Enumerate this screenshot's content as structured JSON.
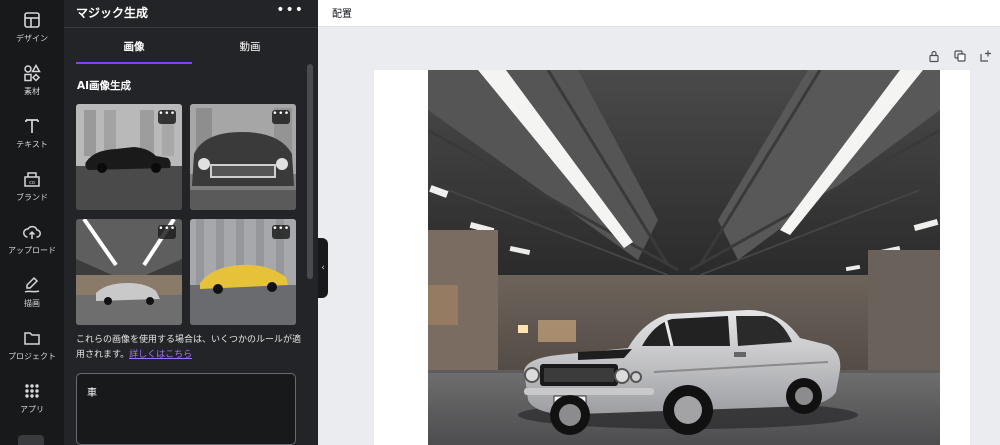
{
  "rail": {
    "items": [
      {
        "label": "デザイン",
        "icon": "layout-icon"
      },
      {
        "label": "素材",
        "icon": "shapes-icon"
      },
      {
        "label": "テキスト",
        "icon": "text-icon"
      },
      {
        "label": "ブランド",
        "icon": "brand-icon"
      },
      {
        "label": "アップロード",
        "icon": "upload-cloud-icon"
      },
      {
        "label": "描画",
        "icon": "draw-icon"
      },
      {
        "label": "プロジェクト",
        "icon": "folder-icon"
      },
      {
        "label": "アプリ",
        "icon": "apps-grid-icon"
      }
    ]
  },
  "panel": {
    "title": "マジック生成",
    "more": "•••",
    "tabs": [
      {
        "label": "画像",
        "active": true
      },
      {
        "label": "動画",
        "active": false
      }
    ],
    "section_heading": "AI画像生成",
    "thumb_more": "•••",
    "notice_text": "これらの画像を使用する場合は、いくつかのルールが適用されます。",
    "notice_link": "詳しくはこちら",
    "prompt_value": "車",
    "collapse_icon": "‹"
  },
  "topbar": {
    "position_label": "配置"
  },
  "colors": {
    "rail_bg": "#18191b",
    "panel_bg": "#232427",
    "accent": "#8b3dff",
    "link": "#a270ff",
    "workspace_bg": "#ebecf0"
  }
}
